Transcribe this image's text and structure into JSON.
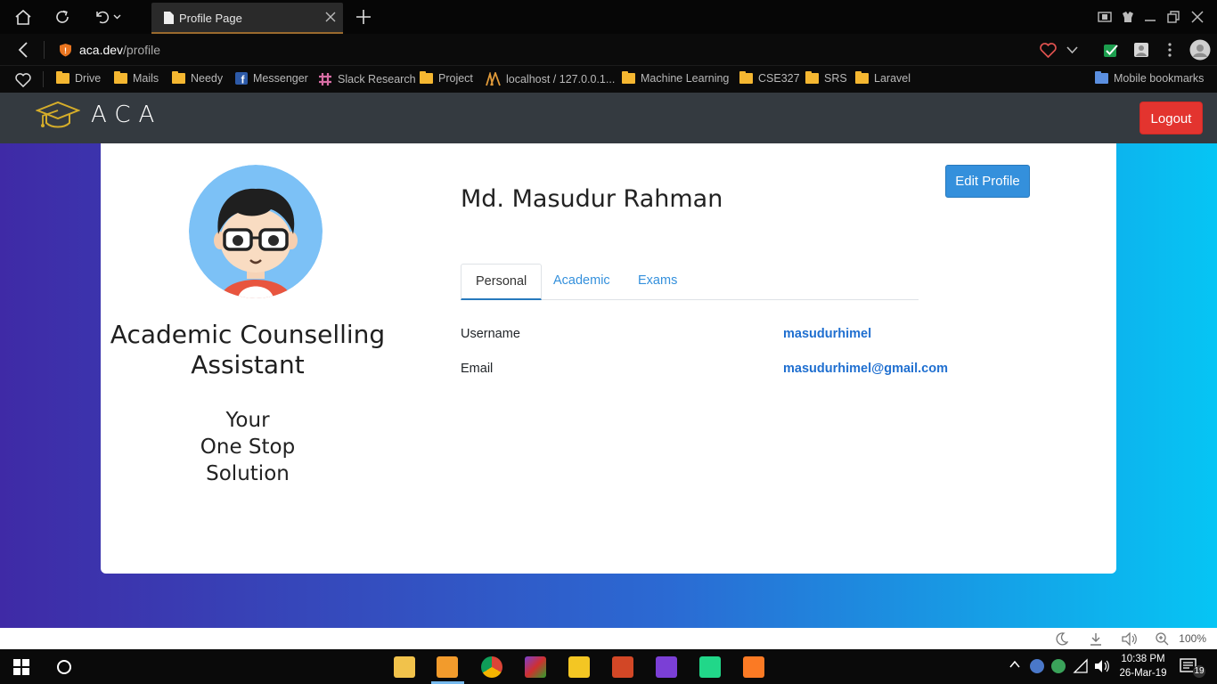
{
  "browser": {
    "tab_title": "Profile Page",
    "url_domain": "aca.dev",
    "url_path": "/profile",
    "bookmarks": [
      "Drive",
      "Mails",
      "Needy",
      "Messenger",
      "Slack Research",
      "Project",
      "localhost / 127.0.0.1...",
      "Machine Learning",
      "CSE327",
      "SRS",
      "Laravel"
    ],
    "mobile_bookmarks": "Mobile bookmarks",
    "zoom": "100%"
  },
  "navbar": {
    "brand": "ACA",
    "logout_label": "Logout"
  },
  "profile": {
    "app_title": "Academic Counselling Assistant",
    "tagline": [
      "Your",
      "One Stop",
      "Solution"
    ],
    "name": "Md. Masudur Rahman",
    "edit_label": "Edit Profile",
    "tabs": [
      "Personal",
      "Academic",
      "Exams"
    ],
    "fields": [
      {
        "label": "Username",
        "value": "masudurhimel"
      },
      {
        "label": "Email",
        "value": "masudurhimel@gmail.com"
      }
    ]
  },
  "taskbar": {
    "time": "10:38 PM",
    "date": "26-Mar-19",
    "notifications": "19"
  },
  "colors": {
    "navbar": "#343a40",
    "logout": "#e3342f",
    "primary": "#3490dc",
    "gradient_start": "#3f2aa6",
    "gradient_end": "#06c5f4"
  }
}
